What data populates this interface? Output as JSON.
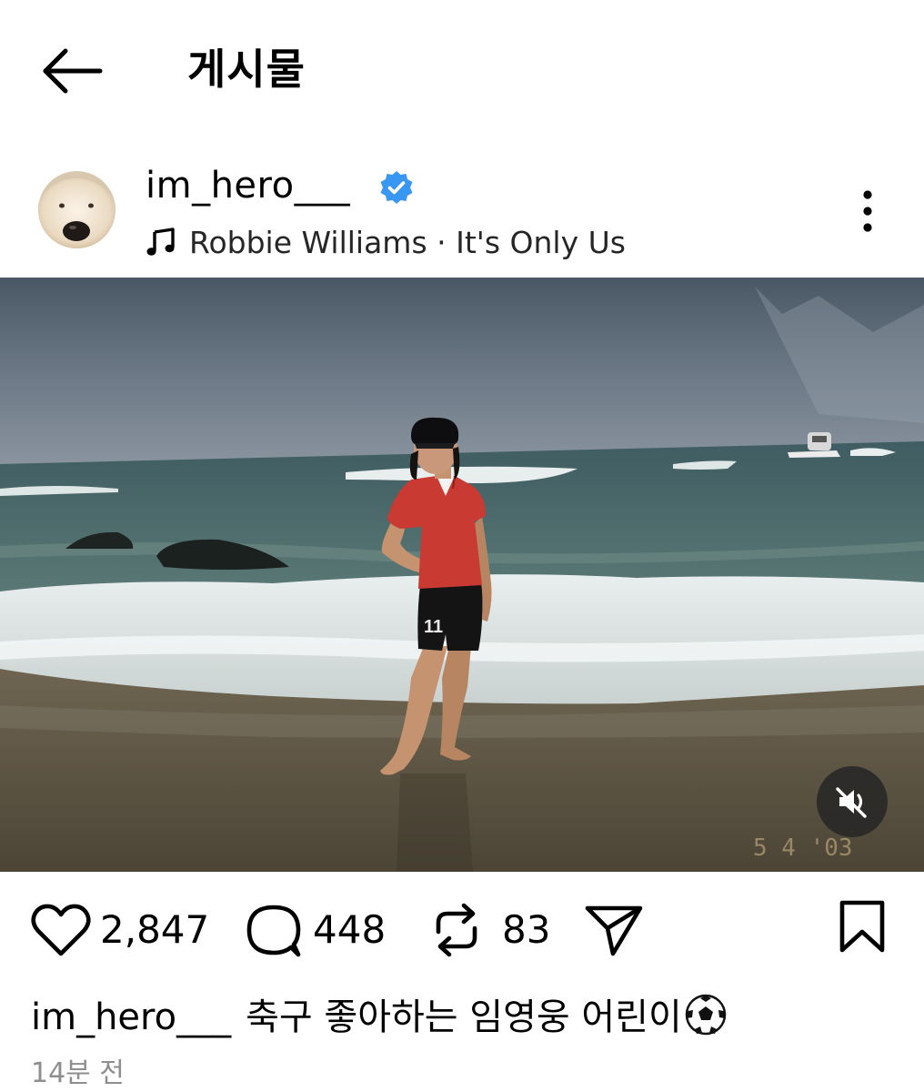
{
  "header": {
    "title": "게시물",
    "back_icon": "arrow-left-icon"
  },
  "post": {
    "username": "im_hero___",
    "verified": true,
    "music": {
      "icon": "music-note-icon",
      "label": "Robbie Williams · It's Only Us"
    },
    "more_icon": "more-vertical-icon",
    "media": {
      "type": "video",
      "muted": true,
      "mute_icon": "speaker-muted-icon",
      "photo_date_stamp": "5 4 '03"
    },
    "actions": {
      "likes": "2,847",
      "comments": "448",
      "reposts": "83",
      "like_icon": "heart-icon",
      "comment_icon": "comment-bubble-icon",
      "repost_icon": "repost-icon",
      "share_icon": "send-icon",
      "save_icon": "bookmark-icon"
    },
    "caption": {
      "username": "im_hero___",
      "text": "축구 좋아하는 임영웅 어린이",
      "emoji": "soccer-ball-icon"
    },
    "timestamp": "14분 전"
  },
  "colors": {
    "verified_blue": "#3897f0",
    "shirt_red": "#c83a32",
    "timestamp_gray": "#8e8e8e"
  }
}
